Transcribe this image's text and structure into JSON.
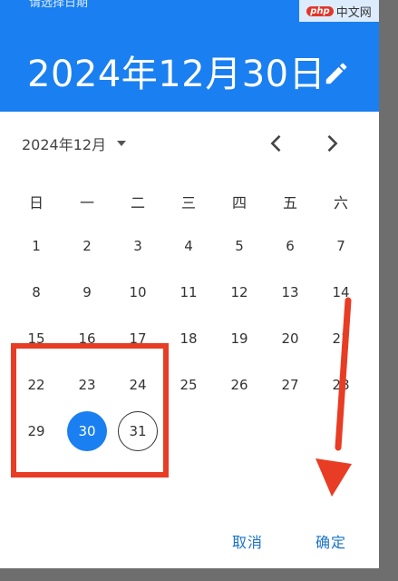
{
  "header": {
    "subtitle": "请选择日期",
    "date": "2024年12月30日",
    "edit_icon": "pencil-icon",
    "color": "#1a7ff0"
  },
  "watermark": {
    "logo": "php",
    "text": "中文网"
  },
  "calendar": {
    "month_label": "2024年12月",
    "dropdown_icon": "dropdown-triangle-icon",
    "prev_icon": "chevron-left-icon",
    "next_icon": "chevron-right-icon",
    "weekdays": [
      "日",
      "一",
      "二",
      "三",
      "四",
      "五",
      "六"
    ],
    "days": [
      "1",
      "2",
      "3",
      "4",
      "5",
      "6",
      "7",
      "8",
      "9",
      "10",
      "11",
      "12",
      "13",
      "14",
      "15",
      "16",
      "17",
      "18",
      "19",
      "20",
      "21",
      "22",
      "23",
      "24",
      "25",
      "26",
      "27",
      "28",
      "29",
      "30",
      "31"
    ],
    "selected_day": "30",
    "today_day": "31"
  },
  "actions": {
    "cancel": "取消",
    "confirm": "确定"
  },
  "annotation_colors": {
    "highlight": "#e83c24"
  }
}
